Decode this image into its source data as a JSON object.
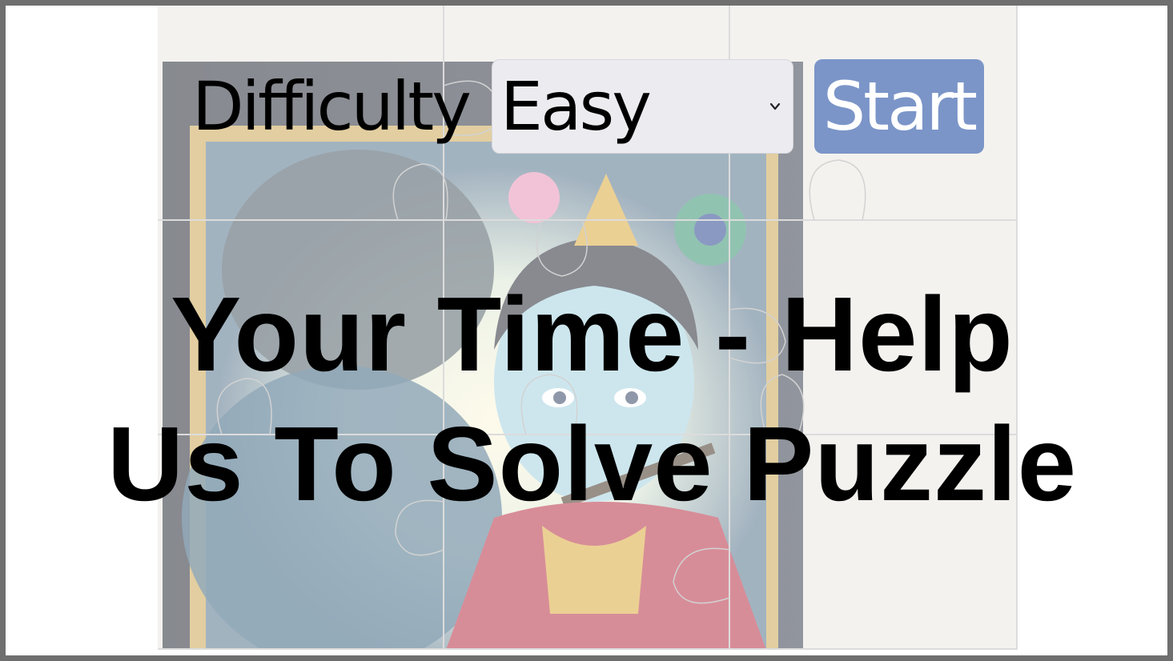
{
  "controls": {
    "difficulty_label": "Difficulty",
    "difficulty_value": "Easy",
    "start_label": "Start"
  },
  "message": {
    "line1": "Your Time - Help",
    "line2": "Us To Solve Puzzle"
  },
  "colors": {
    "start_button": "#7b95c8",
    "frame_border": "#6f6f6f",
    "select_bg": "#ecebf0"
  },
  "icons": {
    "select_arrow": "chevron-down-icon"
  }
}
